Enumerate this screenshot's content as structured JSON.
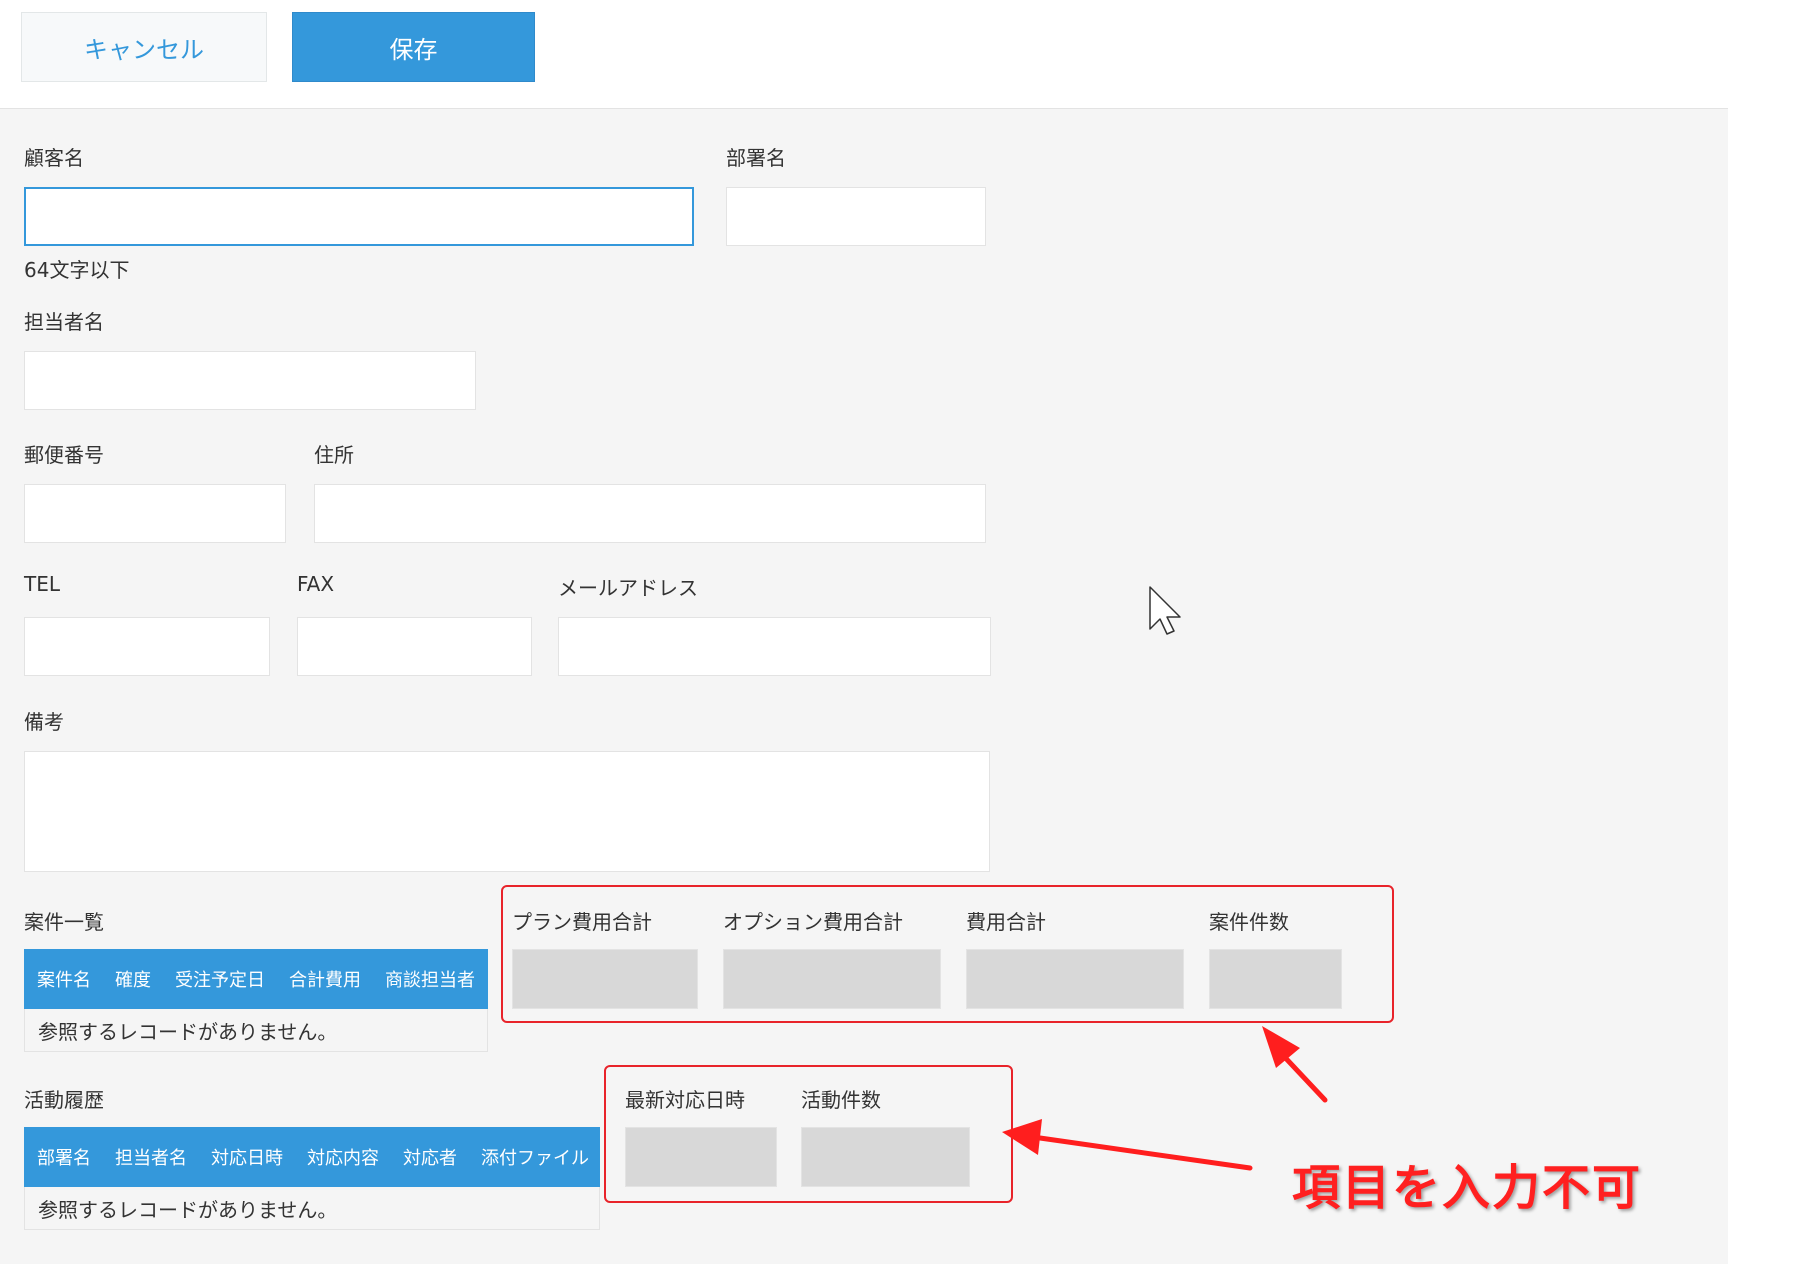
{
  "toolbar": {
    "cancel_label": "キャンセル",
    "save_label": "保存"
  },
  "fields": {
    "customer_name": {
      "label": "顧客名",
      "hint": "64文字以下",
      "value": ""
    },
    "department": {
      "label": "部署名",
      "value": ""
    },
    "contact_person": {
      "label": "担当者名",
      "value": ""
    },
    "postal_code": {
      "label": "郵便番号",
      "value": ""
    },
    "address": {
      "label": "住所",
      "value": ""
    },
    "tel": {
      "label": "TEL",
      "value": ""
    },
    "fax": {
      "label": "FAX",
      "value": ""
    },
    "email": {
      "label": "メールアドレス",
      "value": ""
    },
    "notes": {
      "label": "備考",
      "value": ""
    }
  },
  "deals_table": {
    "label": "案件一覧",
    "columns": [
      "案件名",
      "確度",
      "受注予定日",
      "合計費用",
      "商談担当者"
    ],
    "empty_message": "参照するレコードがありません。"
  },
  "deal_totals": {
    "plan_cost_total": {
      "label": "プラン費用合計"
    },
    "option_cost_total": {
      "label": "オプション費用合計"
    },
    "cost_total": {
      "label": "費用合計"
    },
    "deal_count": {
      "label": "案件件数"
    }
  },
  "activity_table": {
    "label": "活動履歴",
    "columns": [
      "部署名",
      "担当者名",
      "対応日時",
      "対応内容",
      "対応者",
      "添付ファイル"
    ],
    "empty_message": "参照するレコードがありません。"
  },
  "activity_totals": {
    "latest_response": {
      "label": "最新対応日時"
    },
    "activity_count": {
      "label": "活動件数"
    }
  },
  "annotation": {
    "text": "項目を入力不可"
  },
  "colors": {
    "accent": "#3498db",
    "annotation_red": "#e8232a",
    "disabled_field": "#d8d8d8",
    "form_background": "#f5f5f5"
  }
}
